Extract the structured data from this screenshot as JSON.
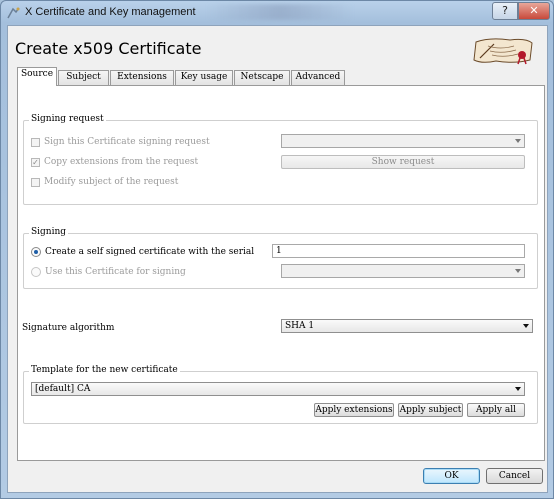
{
  "window": {
    "title": "X Certificate and Key management",
    "help_label": "?",
    "close_label": "✕"
  },
  "dialog": {
    "title": "Create x509 Certificate"
  },
  "tabs": [
    {
      "label": "Source",
      "active": true
    },
    {
      "label": "Subject",
      "active": false
    },
    {
      "label": "Extensions",
      "active": false
    },
    {
      "label": "Key usage",
      "active": false
    },
    {
      "label": "Netscape",
      "active": false
    },
    {
      "label": "Advanced",
      "active": false
    }
  ],
  "signing_request": {
    "group_title": "Signing request",
    "sign_request_label": "Sign this Certificate signing request",
    "sign_request_checked": false,
    "copy_ext_label": "Copy extensions from the request",
    "copy_ext_checked": true,
    "modify_subject_label": "Modify subject of the request",
    "modify_subject_checked": false,
    "request_select_value": "",
    "show_request_label": "Show request"
  },
  "signing": {
    "group_title": "Signing",
    "self_signed_label": "Create a self signed certificate with the serial",
    "self_signed_selected": true,
    "serial_value": "1",
    "use_cert_label": "Use this Certificate for signing",
    "use_cert_selected": false,
    "cert_select_value": ""
  },
  "signature_algorithm": {
    "label": "Signature algorithm",
    "value": "SHA 1"
  },
  "template": {
    "group_title": "Template for the new certificate",
    "value": "[default] CA",
    "apply_extensions_label": "Apply extensions",
    "apply_subject_label": "Apply subject",
    "apply_all_label": "Apply all"
  },
  "footer": {
    "ok_label": "OK",
    "cancel_label": "Cancel"
  }
}
